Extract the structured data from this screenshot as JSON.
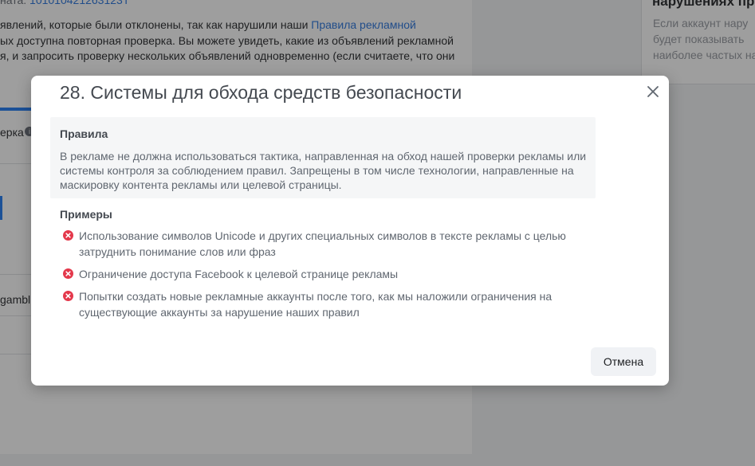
{
  "background": {
    "account_label": "ната: ",
    "account_number": "101010421263123Т",
    "paragraph_lines": [
      "явлений, которые были отклонены, так как нарушили наши ",
      "ых доступна повторная проверка. Вы можете увидеть, какие из объявлений рекламной",
      "я, и запросить проверку нескольких объявлений одновременно (если считаете, что они"
    ],
    "paragraph_link": "Правила рекламной",
    "tab_label": "ерка",
    "info_icon": "info-icon",
    "row_text": "gambl",
    "right_card_title": "нарушениях пр",
    "right_card_lines": [
      "Если аккаунт нару",
      "будет показывать",
      "наиболее частых на"
    ]
  },
  "modal": {
    "title": "28. Системы для обхода средств безопасности",
    "close_icon": "close-icon",
    "rules": {
      "heading": "Правила",
      "text": "В рекламе не должна использоваться тактика, направленная на обход нашей проверки рекламы или системы контроля за соблюдением правил. Запрещены в том числе технологии, направленные на маскировку контента рекламы или целевой страницы."
    },
    "examples": {
      "heading": "Примеры",
      "icon": "x-circle-icon",
      "icon_color": "#e4384b",
      "items": [
        "Использование символов Unicode и других специальных символов в тексте рекламы с целью затруднить понимание слов или фраз",
        "Ограничение доступа Facebook к целевой странице рекламы",
        "Попытки создать новые рекламные аккаунты после того, как мы наложили ограничения на существующие аккаунты за нарушение наших правил"
      ]
    },
    "cancel_label": "Отмена"
  },
  "colors": {
    "link": "#216fdb",
    "accent": "#1877f2",
    "error": "#e4384b"
  }
}
